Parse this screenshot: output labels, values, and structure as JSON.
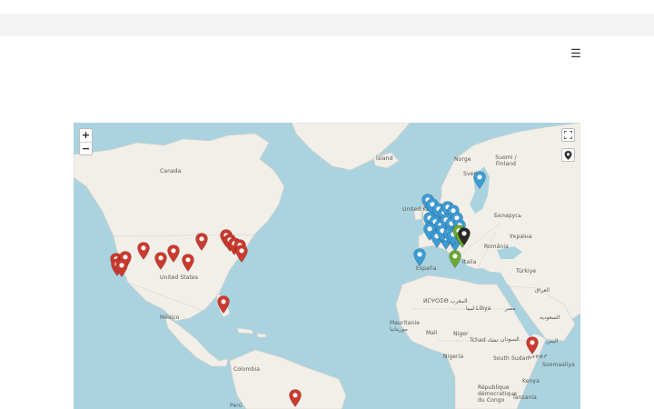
{
  "header": {
    "menu_icon": "☰"
  },
  "map": {
    "controls": {
      "zoom_in": "+",
      "zoom_out": "−"
    },
    "labels": [
      {
        "text": "Canada",
        "id": "canada"
      },
      {
        "text": "United States",
        "id": "united-states"
      },
      {
        "text": "México",
        "id": "mexico"
      },
      {
        "text": "Colombia",
        "id": "colombia"
      },
      {
        "text": "Perú",
        "id": "peru"
      },
      {
        "text": "Ísland",
        "id": "island"
      },
      {
        "text": "Norge",
        "id": "norge"
      },
      {
        "text": "Sverige",
        "id": "sverige"
      },
      {
        "text": "Suomi / Finland",
        "id": "suomi"
      },
      {
        "text": "United Kingdom",
        "id": "united-kingdom"
      },
      {
        "text": "España",
        "id": "espana"
      },
      {
        "text": "Italia",
        "id": "italia"
      },
      {
        "text": "Беларусь",
        "id": "belarus"
      },
      {
        "text": "Україна",
        "id": "ukraine"
      },
      {
        "text": "România",
        "id": "romania"
      },
      {
        "text": "Türkiye",
        "id": "turkiye"
      },
      {
        "text": "العراق",
        "id": "iraq"
      },
      {
        "text": "السعودية",
        "id": "saudi"
      },
      {
        "text": "مصر",
        "id": "egypt"
      },
      {
        "text": "ⵍⵎⵖⵔⵉⴱ المغرب",
        "id": "morocco"
      },
      {
        "text": "ليبيا Libya",
        "id": "libya"
      },
      {
        "text": "Mauritanie موريتانيا",
        "id": "mauritania"
      },
      {
        "text": "Mali",
        "id": "mali"
      },
      {
        "text": "Niger",
        "id": "niger"
      },
      {
        "text": "Tchad تشاد",
        "id": "tchad"
      },
      {
        "text": "السودان",
        "id": "sudan"
      },
      {
        "text": "Nigeria",
        "id": "nigeria"
      },
      {
        "text": "South Sudan",
        "id": "south-sudan"
      },
      {
        "text": "ኢትዮጵያ",
        "id": "ethiopia"
      },
      {
        "text": "Soomaaliya",
        "id": "somalia"
      },
      {
        "text": "République démocratique du Congo",
        "id": "drc"
      },
      {
        "text": "Kenya",
        "id": "kenya"
      },
      {
        "text": "Tanzania",
        "id": "tanzania"
      },
      {
        "text": "اليمن",
        "id": "yemen"
      }
    ],
    "colors": {
      "red": "#cb3a2e",
      "blue": "#3d9bd4",
      "green": "#6da832",
      "black": "#2b2b2b",
      "water": "#aad3df",
      "land": "#f2efe9"
    }
  }
}
